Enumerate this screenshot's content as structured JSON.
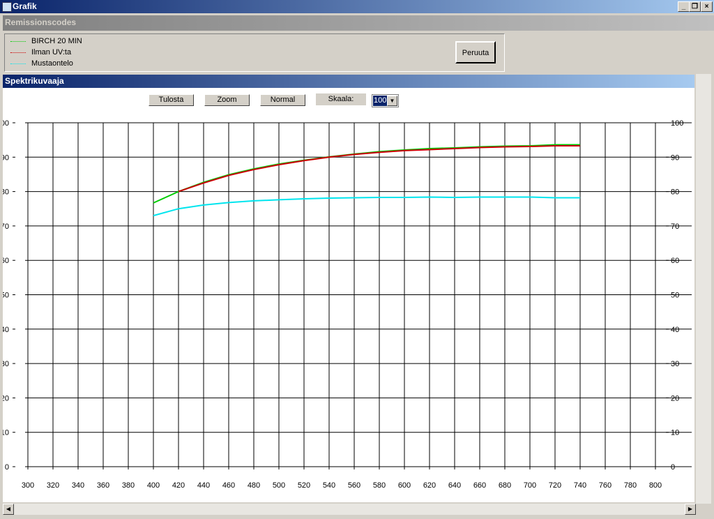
{
  "window": {
    "title": "Grafik",
    "controls": [
      "_",
      "❐",
      "×"
    ]
  },
  "legend_panel": {
    "title": "Remissionscodes",
    "cancel_label": "Peruuta"
  },
  "chart_panel": {
    "title": "Spektrikuvaaja",
    "print_label": "Tulosta",
    "zoom_label": "Zoom",
    "normal_label": "Normal",
    "scale_label": "Skaala:",
    "scale_value": "100"
  },
  "chart_data": {
    "type": "line",
    "xlim": [
      300,
      800
    ],
    "ylim": [
      0,
      100
    ],
    "grid": true,
    "legend": "top-left (separate panel)",
    "xticks": [
      300,
      320,
      340,
      360,
      380,
      400,
      420,
      440,
      460,
      480,
      500,
      520,
      540,
      560,
      580,
      600,
      620,
      640,
      660,
      680,
      700,
      720,
      740,
      760,
      780,
      800
    ],
    "yticks": [
      0,
      10,
      20,
      30,
      40,
      50,
      60,
      70,
      80,
      90,
      100
    ],
    "series": [
      {
        "name": "BIRCH 20 MIN",
        "color": "#00cc00",
        "x": [
          400,
          420,
          440,
          460,
          480,
          500,
          520,
          540,
          560,
          580,
          600,
          620,
          640,
          660,
          680,
          700,
          720,
          740
        ],
        "y": [
          76.7,
          80,
          82.7,
          84.9,
          86.6,
          88,
          89.1,
          90.1,
          90.9,
          91.6,
          92.1,
          92.5,
          92.7,
          93,
          93.2,
          93.3,
          93.6,
          93.6
        ]
      },
      {
        "name": "Ilman UV:ta",
        "color": "#cc0000",
        "x": [
          420,
          440,
          460,
          480,
          500,
          520,
          540,
          560,
          580,
          600,
          620,
          640,
          660,
          680,
          700,
          720,
          740
        ],
        "y": [
          80,
          82.5,
          84.7,
          86.4,
          87.8,
          89,
          90,
          90.8,
          91.4,
          91.9,
          92.2,
          92.5,
          92.8,
          93,
          93.1,
          93.3,
          93.3
        ]
      },
      {
        "name": "Mustaontelo",
        "color": "#00e5ee",
        "x": [
          400,
          420,
          440,
          460,
          480,
          500,
          520,
          540,
          560,
          580,
          600,
          620,
          640,
          660,
          680,
          700,
          720,
          740
        ],
        "y": [
          73,
          75,
          76.1,
          76.8,
          77.3,
          77.6,
          77.9,
          78.1,
          78.2,
          78.3,
          78.3,
          78.4,
          78.3,
          78.4,
          78.4,
          78.4,
          78.2,
          78.2
        ]
      }
    ]
  }
}
